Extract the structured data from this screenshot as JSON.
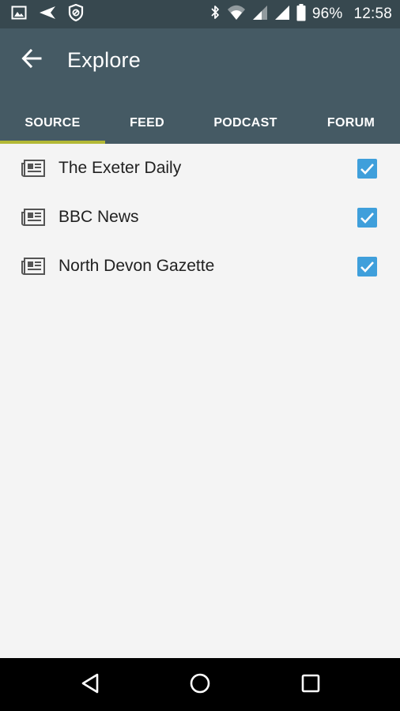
{
  "status_bar": {
    "left_icons": [
      "image-notification-icon",
      "send-notification-icon",
      "shield-notification-icon"
    ],
    "right_icons": [
      "bluetooth-icon",
      "wifi-icon",
      "signal-icon",
      "signal-icon",
      "battery-icon"
    ],
    "battery": "96%",
    "time": "12:58"
  },
  "app_bar": {
    "title": "Explore",
    "back_icon": "arrow-back-icon"
  },
  "tabs": [
    {
      "label": "SOURCE",
      "active": true
    },
    {
      "label": "FEED",
      "active": false
    },
    {
      "label": "PODCAST",
      "active": false
    },
    {
      "label": "FORUM",
      "active": false
    }
  ],
  "sources": [
    {
      "label": "The Exeter Daily",
      "icon": "newspaper-icon",
      "checked": true
    },
    {
      "label": "BBC News",
      "icon": "newspaper-icon",
      "checked": true
    },
    {
      "label": "North Devon Gazette",
      "icon": "newspaper-icon",
      "checked": true
    }
  ],
  "nav_bar": {
    "buttons": [
      "back-triangle-icon",
      "home-circle-icon",
      "recents-square-icon"
    ]
  },
  "colors": {
    "status_bar": "#37484f",
    "app_bar": "#455a64",
    "tab_indicator": "#b3b936",
    "checkbox": "#3f9fdb",
    "background": "#f4f4f4"
  }
}
